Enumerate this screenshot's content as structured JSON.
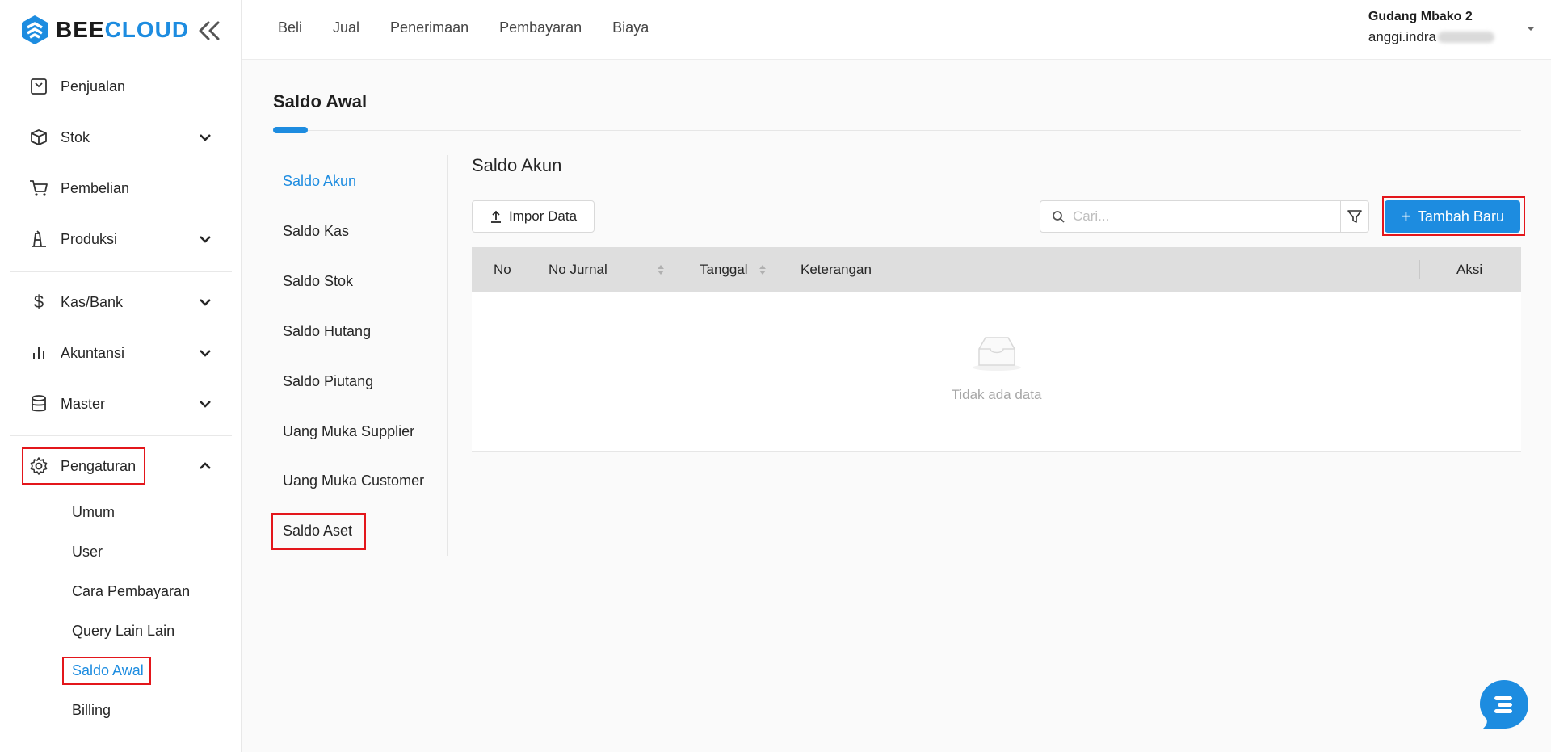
{
  "app": {
    "brand_part1": "BEE",
    "brand_part2": "CLOUD"
  },
  "colors": {
    "accent": "#1d8ce0",
    "highlight": "#e3161b"
  },
  "sidebar": {
    "items": [
      {
        "label": "Penjualan",
        "icon": "receipt-icon"
      },
      {
        "label": "Stok",
        "icon": "box-icon"
      },
      {
        "label": "Pembelian",
        "icon": "cart-icon"
      },
      {
        "label": "Produksi",
        "icon": "factory-icon"
      },
      {
        "label": "Kas/Bank",
        "icon": "dollar-icon"
      },
      {
        "label": "Akuntansi",
        "icon": "bar-chart-icon"
      },
      {
        "label": "Master",
        "icon": "database-icon"
      },
      {
        "label": "Pengaturan",
        "icon": "gear-icon"
      }
    ],
    "sub_items": [
      "Umum",
      "User",
      "Cara Pembayaran",
      "Query Lain Lain",
      "Saldo Awal",
      "Billing"
    ],
    "active_sub": "Saldo Awal"
  },
  "topbar": {
    "menu": [
      "Beli",
      "Jual",
      "Penerimaan",
      "Pembayaran",
      "Biaya"
    ],
    "company": "Gudang Mbako 2",
    "email": "anggi.indra"
  },
  "page": {
    "title": "Saldo Awal",
    "subnav": [
      "Saldo Akun",
      "Saldo Kas",
      "Saldo Stok",
      "Saldo Hutang",
      "Saldo Piutang",
      "Uang Muka Supplier",
      "Uang Muka Customer",
      "Saldo Aset"
    ],
    "active_subnav": "Saldo Akun",
    "section_title": "Saldo Akun",
    "import_label": "Impor Data",
    "search_placeholder": "Cari...",
    "add_label": "Tambah Baru",
    "table": {
      "columns": [
        "No",
        "No Jurnal",
        "Tanggal",
        "Keterangan",
        "Aksi"
      ],
      "empty_text": "Tidak ada data"
    }
  }
}
